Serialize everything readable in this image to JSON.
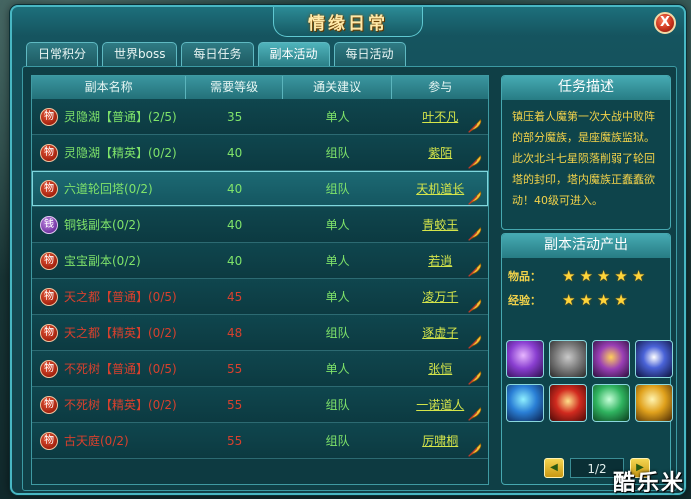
{
  "window": {
    "title": "情缘日常",
    "close_label": "X"
  },
  "tabs": [
    {
      "label": "日常积分"
    },
    {
      "label": "世界boss"
    },
    {
      "label": "每日任务"
    },
    {
      "label": "副本活动"
    },
    {
      "label": "每日活动"
    }
  ],
  "table": {
    "headers": [
      "副本名称",
      "需要等级",
      "通关建议",
      "参与"
    ],
    "rows": [
      {
        "badge": "物",
        "name": "灵隐湖【普通】(2/5)",
        "level": "35",
        "mode": "单人",
        "participant": "叶不凡"
      },
      {
        "badge": "物",
        "name": "灵隐湖【精英】(0/2)",
        "level": "40",
        "mode": "组队",
        "participant": "紫陌"
      },
      {
        "badge": "物",
        "name": "六道轮回塔(0/2)",
        "level": "40",
        "mode": "组队",
        "participant": "天机道长"
      },
      {
        "badge": "钱",
        "name": "铜钱副本(0/2)",
        "level": "40",
        "mode": "单人",
        "participant": "青蛟王"
      },
      {
        "badge": "物",
        "name": "宝宝副本(0/2)",
        "level": "40",
        "mode": "单人",
        "participant": "若逍"
      },
      {
        "badge": "物",
        "name": "天之都【普通】(0/5)",
        "level": "45",
        "mode": "单人",
        "participant": "凌万千"
      },
      {
        "badge": "物",
        "name": "天之都【精英】(0/2)",
        "level": "48",
        "mode": "组队",
        "participant": "逐虚子"
      },
      {
        "badge": "物",
        "name": "不死树【普通】(0/5)",
        "level": "55",
        "mode": "单人",
        "participant": "张恒"
      },
      {
        "badge": "物",
        "name": "不死树【精英】(0/2)",
        "level": "55",
        "mode": "组队",
        "participant": "一诺道人"
      },
      {
        "badge": "物",
        "name": "古天庭(0/2)",
        "level": "55",
        "mode": "组队",
        "participant": "厉啸桐"
      }
    ]
  },
  "task_desc": {
    "title": "任务描述",
    "text": "镇压着人魔第一次大战中败阵的部分魔族，是座魔族监狱。此次北斗七星陨落削弱了轮回塔的封印，塔内魔族正蠢蠢欲动！40级可进入。"
  },
  "rewards": {
    "title": "副本活动产出",
    "items_label": "物品：",
    "items_stars": 5,
    "exp_label": "经验：",
    "exp_stars": 4,
    "item_icons": [
      "purple-gem-icon",
      "stone-tablet-icon",
      "spirit-beast-icon",
      "eye-orb-icon",
      "blue-crystal-icon",
      "red-envelope-icon",
      "green-crystal-icon",
      "golden-crystal-icon"
    ]
  },
  "pager": {
    "text": "1/2",
    "prev": "◀",
    "next": "▶"
  },
  "watermark": "酷乐米",
  "colors": {
    "accent": "#46a8b0",
    "available": "#7fe36a",
    "locked": "#d8402d",
    "link": "#d5e54a",
    "star": "#ffd53a"
  }
}
